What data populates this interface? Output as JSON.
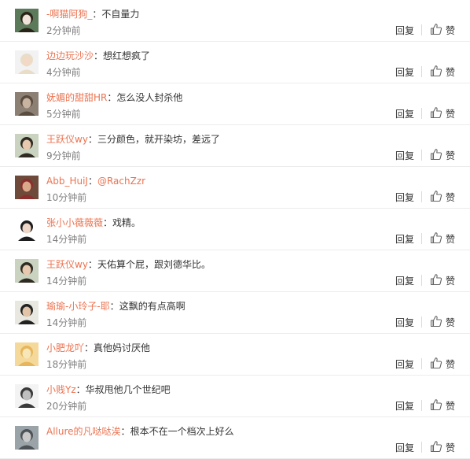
{
  "comments": [
    {
      "user": "-啊猫阿狗_",
      "text": "不自量力",
      "time": "2分钟前",
      "avatar": {
        "bg": "#5a7a5a",
        "fg": "#efe4d7",
        "hair": "#2a2418"
      }
    },
    {
      "user": "边边玩沙沙",
      "text": "想红想疯了",
      "time": "4分钟前",
      "avatar": {
        "bg": "#f2f2f2",
        "fg": "#f1d9c6",
        "hair": "#e9ddc8"
      }
    },
    {
      "user": "妩媚的甜甜HR",
      "text": "怎么没人封杀他",
      "time": "5分钟前",
      "avatar": {
        "bg": "#8c7f74",
        "fg": "#c7b39f",
        "hair": "#5b4c40"
      }
    },
    {
      "user": "王跃仪wy",
      "text": "三分颜色，就开染坊，差远了",
      "time": "9分钟前",
      "avatar": {
        "bg": "#c9d3c0",
        "fg": "#e6c9ae",
        "hair": "#2f2a22"
      }
    },
    {
      "user": "Abb_HuiJ",
      "text": "",
      "mention": "@RachZzr",
      "time": "10分钟前",
      "avatar": {
        "bg": "#6e4a3a",
        "fg": "#d9a98a",
        "hair": "#8a2e2e"
      }
    },
    {
      "user": "张小小薇薇薇",
      "text": "戏精。",
      "time": "14分钟前",
      "avatar": {
        "bg": "#ffffff",
        "fg": "#efd7c8",
        "hair": "#1d1d1d"
      }
    },
    {
      "user": "王跃仪wy",
      "text": "天佑算个屁，跟刘德华比。",
      "time": "14分钟前",
      "avatar": {
        "bg": "#c9d3c0",
        "fg": "#e6c9ae",
        "hair": "#2f2a22"
      }
    },
    {
      "user": "瑜瑜-小玲子-耶",
      "text": "这飘的有点高啊",
      "time": "14分钟前",
      "avatar": {
        "bg": "#e8e8e0",
        "fg": "#e2c4a8",
        "hair": "#222222"
      }
    },
    {
      "user": "小肥龙吖",
      "text": "真他妈讨厌他",
      "time": "18分钟前",
      "avatar": {
        "bg": "#f4d99a",
        "fg": "#f6e6b8",
        "hair": "#e7b65c"
      }
    },
    {
      "user": "小贱Yz",
      "text": "华叔甩他几个世纪吧",
      "time": "20分钟前",
      "avatar": {
        "bg": "#f3f3f3",
        "fg": "#bfbfbf",
        "hair": "#3a3a3a"
      }
    },
    {
      "user": "Allure的凡哒哒涘",
      "text": "根本不在一个档次上好么",
      "time": "",
      "avatar": {
        "bg": "#9aa3a8",
        "fg": "#c9c9c9",
        "hair": "#4d5256"
      }
    }
  ],
  "labels": {
    "colon": "：",
    "reply": "回复",
    "like": "赞"
  },
  "colors": {
    "username": "#eb7350",
    "time": "#808080",
    "divider": "#ececec"
  }
}
